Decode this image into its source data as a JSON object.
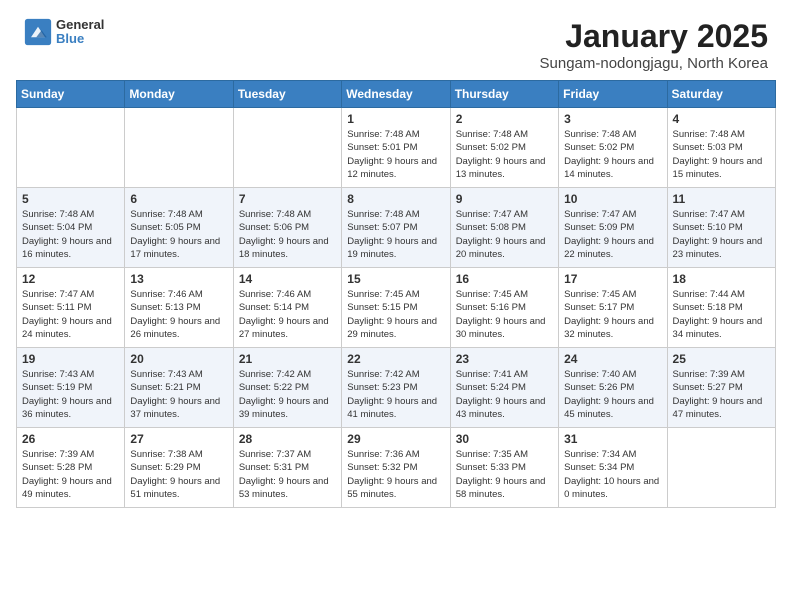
{
  "header": {
    "logo_line1": "General",
    "logo_line2": "Blue",
    "title": "January 2025",
    "subtitle": "Sungam-nodongjagu, North Korea"
  },
  "days_of_week": [
    "Sunday",
    "Monday",
    "Tuesday",
    "Wednesday",
    "Thursday",
    "Friday",
    "Saturday"
  ],
  "weeks": [
    [
      {
        "day": "",
        "content": ""
      },
      {
        "day": "",
        "content": ""
      },
      {
        "day": "",
        "content": ""
      },
      {
        "day": "1",
        "content": "Sunrise: 7:48 AM\nSunset: 5:01 PM\nDaylight: 9 hours and 12 minutes."
      },
      {
        "day": "2",
        "content": "Sunrise: 7:48 AM\nSunset: 5:02 PM\nDaylight: 9 hours and 13 minutes."
      },
      {
        "day": "3",
        "content": "Sunrise: 7:48 AM\nSunset: 5:02 PM\nDaylight: 9 hours and 14 minutes."
      },
      {
        "day": "4",
        "content": "Sunrise: 7:48 AM\nSunset: 5:03 PM\nDaylight: 9 hours and 15 minutes."
      }
    ],
    [
      {
        "day": "5",
        "content": "Sunrise: 7:48 AM\nSunset: 5:04 PM\nDaylight: 9 hours and 16 minutes."
      },
      {
        "day": "6",
        "content": "Sunrise: 7:48 AM\nSunset: 5:05 PM\nDaylight: 9 hours and 17 minutes."
      },
      {
        "day": "7",
        "content": "Sunrise: 7:48 AM\nSunset: 5:06 PM\nDaylight: 9 hours and 18 minutes."
      },
      {
        "day": "8",
        "content": "Sunrise: 7:48 AM\nSunset: 5:07 PM\nDaylight: 9 hours and 19 minutes."
      },
      {
        "day": "9",
        "content": "Sunrise: 7:47 AM\nSunset: 5:08 PM\nDaylight: 9 hours and 20 minutes."
      },
      {
        "day": "10",
        "content": "Sunrise: 7:47 AM\nSunset: 5:09 PM\nDaylight: 9 hours and 22 minutes."
      },
      {
        "day": "11",
        "content": "Sunrise: 7:47 AM\nSunset: 5:10 PM\nDaylight: 9 hours and 23 minutes."
      }
    ],
    [
      {
        "day": "12",
        "content": "Sunrise: 7:47 AM\nSunset: 5:11 PM\nDaylight: 9 hours and 24 minutes."
      },
      {
        "day": "13",
        "content": "Sunrise: 7:46 AM\nSunset: 5:13 PM\nDaylight: 9 hours and 26 minutes."
      },
      {
        "day": "14",
        "content": "Sunrise: 7:46 AM\nSunset: 5:14 PM\nDaylight: 9 hours and 27 minutes."
      },
      {
        "day": "15",
        "content": "Sunrise: 7:45 AM\nSunset: 5:15 PM\nDaylight: 9 hours and 29 minutes."
      },
      {
        "day": "16",
        "content": "Sunrise: 7:45 AM\nSunset: 5:16 PM\nDaylight: 9 hours and 30 minutes."
      },
      {
        "day": "17",
        "content": "Sunrise: 7:45 AM\nSunset: 5:17 PM\nDaylight: 9 hours and 32 minutes."
      },
      {
        "day": "18",
        "content": "Sunrise: 7:44 AM\nSunset: 5:18 PM\nDaylight: 9 hours and 34 minutes."
      }
    ],
    [
      {
        "day": "19",
        "content": "Sunrise: 7:43 AM\nSunset: 5:19 PM\nDaylight: 9 hours and 36 minutes."
      },
      {
        "day": "20",
        "content": "Sunrise: 7:43 AM\nSunset: 5:21 PM\nDaylight: 9 hours and 37 minutes."
      },
      {
        "day": "21",
        "content": "Sunrise: 7:42 AM\nSunset: 5:22 PM\nDaylight: 9 hours and 39 minutes."
      },
      {
        "day": "22",
        "content": "Sunrise: 7:42 AM\nSunset: 5:23 PM\nDaylight: 9 hours and 41 minutes."
      },
      {
        "day": "23",
        "content": "Sunrise: 7:41 AM\nSunset: 5:24 PM\nDaylight: 9 hours and 43 minutes."
      },
      {
        "day": "24",
        "content": "Sunrise: 7:40 AM\nSunset: 5:26 PM\nDaylight: 9 hours and 45 minutes."
      },
      {
        "day": "25",
        "content": "Sunrise: 7:39 AM\nSunset: 5:27 PM\nDaylight: 9 hours and 47 minutes."
      }
    ],
    [
      {
        "day": "26",
        "content": "Sunrise: 7:39 AM\nSunset: 5:28 PM\nDaylight: 9 hours and 49 minutes."
      },
      {
        "day": "27",
        "content": "Sunrise: 7:38 AM\nSunset: 5:29 PM\nDaylight: 9 hours and 51 minutes."
      },
      {
        "day": "28",
        "content": "Sunrise: 7:37 AM\nSunset: 5:31 PM\nDaylight: 9 hours and 53 minutes."
      },
      {
        "day": "29",
        "content": "Sunrise: 7:36 AM\nSunset: 5:32 PM\nDaylight: 9 hours and 55 minutes."
      },
      {
        "day": "30",
        "content": "Sunrise: 7:35 AM\nSunset: 5:33 PM\nDaylight: 9 hours and 58 minutes."
      },
      {
        "day": "31",
        "content": "Sunrise: 7:34 AM\nSunset: 5:34 PM\nDaylight: 10 hours and 0 minutes."
      },
      {
        "day": "",
        "content": ""
      }
    ]
  ]
}
